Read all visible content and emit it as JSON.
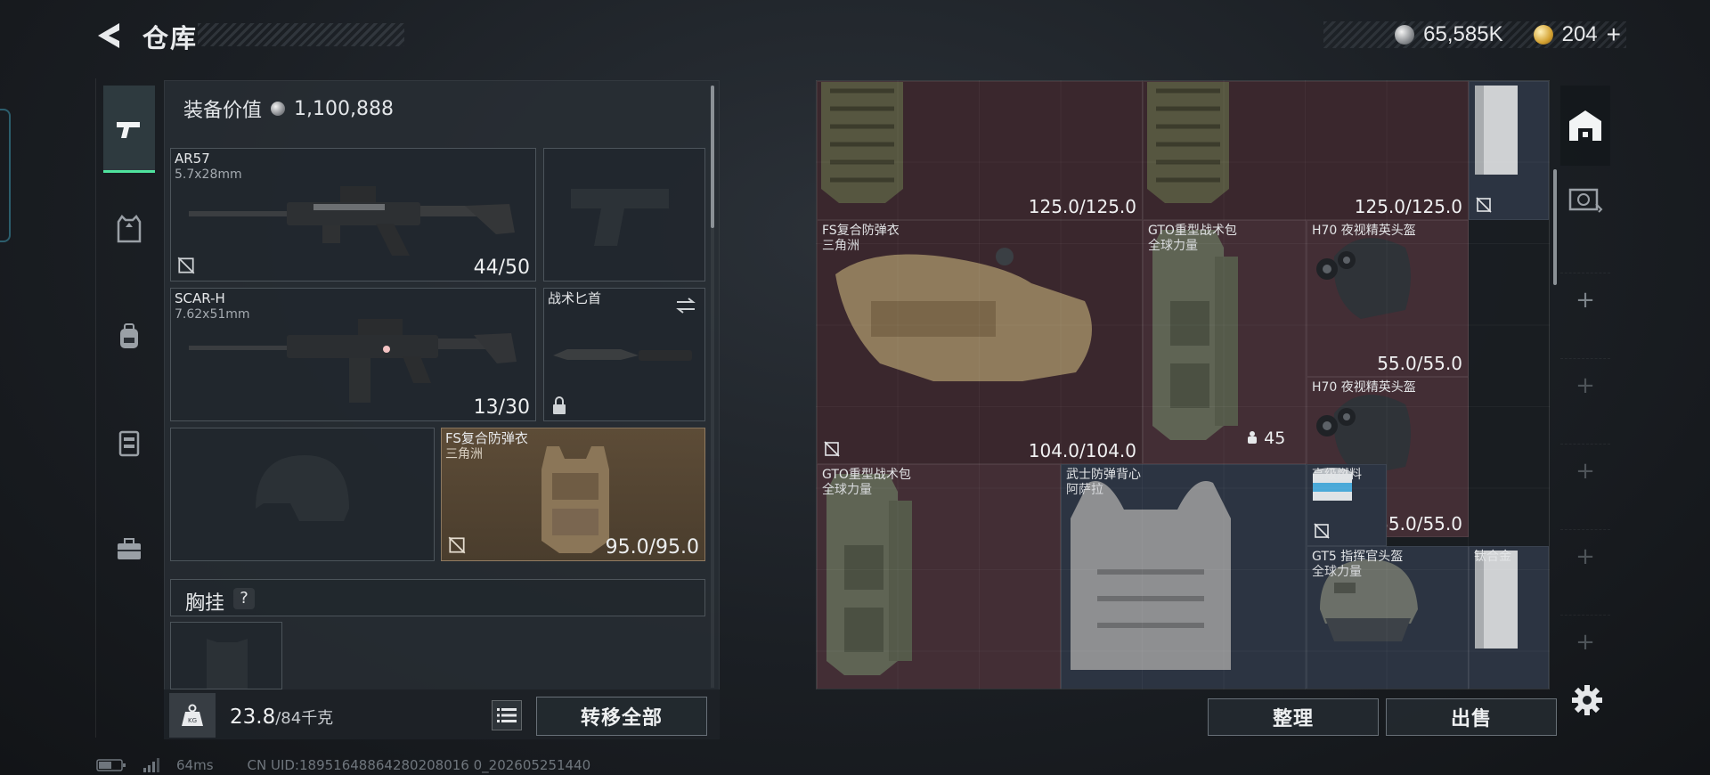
{
  "header": {
    "title": "仓库",
    "currency_silver": "65,585K",
    "currency_gold": "204",
    "gold_add": "+"
  },
  "equipment": {
    "value_label": "装备价值",
    "value": "1,100,888",
    "slots": {
      "primary1": {
        "name": "AR57",
        "ammo": "5.7x28mm",
        "count": "44/50"
      },
      "primary2": {
        "name": "SCAR-H",
        "ammo": "7.62x51mm",
        "count": "13/30"
      },
      "melee": {
        "name": "战术匕首"
      },
      "armor": {
        "name": "FS复合防弹衣",
        "sub": "三角洲",
        "count": "95.0/95.0"
      }
    },
    "chest_rig_label": "胸挂",
    "help": "?"
  },
  "footer": {
    "weight_current": "23.8",
    "weight_max": "/84千克",
    "transfer_all": "转移全部",
    "organize": "整理",
    "sell": "出售"
  },
  "status": {
    "ping": "64ms",
    "uid": "CN UID:18951648864280208016 0_202605251440"
  },
  "stash": {
    "items": [
      {
        "dur": "125.0/125.0"
      },
      {
        "dur": "125.0/125.0"
      },
      {
        "name": "FS复合防弹衣",
        "sub": "三角洲",
        "dur": "104.0/104.0"
      },
      {
        "name": "GTO重型战术包",
        "sub": "全球力量",
        "count": "45"
      },
      {
        "name": "H70 夜视精英头盔",
        "dur": "55.0/55.0"
      },
      {
        "name": "H70 夜视精英头盔",
        "dur": "55.0/55.0"
      },
      {
        "name": "GTO重型战术包",
        "sub": "全球力量"
      },
      {
        "name": "武士防弹背心",
        "sub": "阿萨拉"
      },
      {
        "name": "高级燃料"
      },
      {
        "name": "GT5 指挥官头盔",
        "sub": "全球力量"
      },
      {
        "name": "钛合金"
      }
    ]
  },
  "rail": {
    "plus": "+"
  },
  "colors": {
    "accent": "#4fe39e",
    "stash_red": "#432e35",
    "stash_blue": "#2c3442"
  }
}
